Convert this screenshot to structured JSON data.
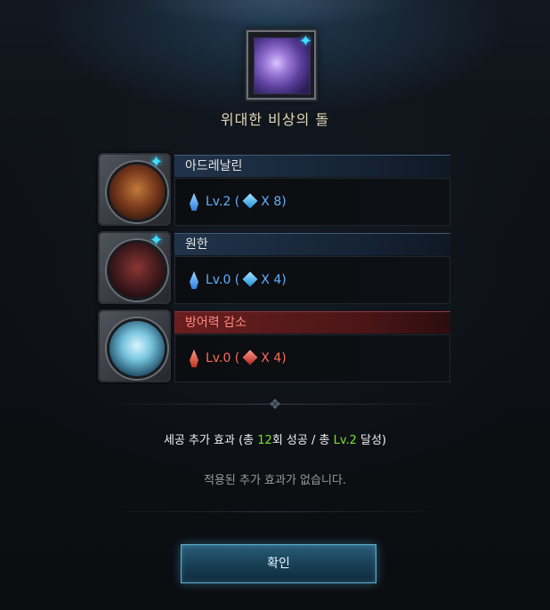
{
  "dialog": {
    "stone_title": "위대한 비상의 돌"
  },
  "skills": [
    {
      "name": "아드레날린",
      "level_text": "Lv.2 (",
      "multiplier": "X 8)",
      "color": "blue",
      "has_sparkle": true
    },
    {
      "name": "원한",
      "level_text": "Lv.0 (",
      "multiplier": "X 4)",
      "color": "blue",
      "has_sparkle": true
    },
    {
      "name": "방어력 감소",
      "level_text": "Lv.0 (",
      "multiplier": "X 4)",
      "color": "red",
      "has_sparkle": false
    }
  ],
  "summary": {
    "prefix": "세공 추가 효과 (총 ",
    "success_count": "12",
    "middle": "회 성공 / 총 ",
    "level": "Lv.2",
    "suffix": " 달성)"
  },
  "message": "적용된 추가 효과가 없습니다.",
  "confirm_label": "확인",
  "colors": {
    "accent_blue": "#62b0ff",
    "accent_red": "#ff6a5a",
    "success_green": "#7ee02f",
    "sparkle": "#3fe0ff"
  },
  "icons": {
    "stone": "purple-crystal-stone-icon",
    "sparkle": "sparkle-icon",
    "crystal": "crystal-icon",
    "gem": "diamond-gem-icon"
  }
}
